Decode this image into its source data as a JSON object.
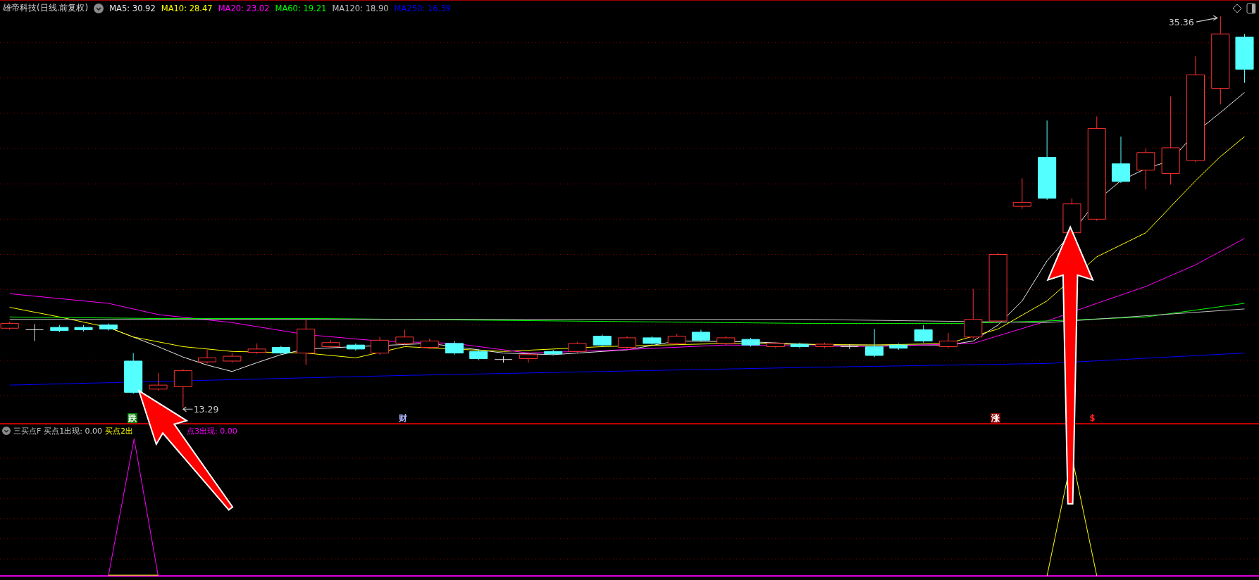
{
  "header": {
    "title": "雄帝科技(日线.前复权)",
    "indicators": [
      {
        "label": "MA5: 30.92",
        "color": "#e8e8e8"
      },
      {
        "label": "MA10: 28.47",
        "color": "#ffff00"
      },
      {
        "label": "MA20: 23.02",
        "color": "#ff00ff"
      },
      {
        "label": "MA60: 19.21",
        "color": "#00ff00"
      },
      {
        "label": "MA120: 18.90",
        "color": "#c0c0c0"
      },
      {
        "label": "MA250: 16.39",
        "color": "#0000ff"
      }
    ]
  },
  "price_chart": {
    "high_label": "35.36",
    "low_label": "13.29"
  },
  "signal_marks": [
    {
      "text": "跌",
      "kind": "boxed",
      "color": "#008000"
    },
    {
      "text": "财",
      "kind": "plain",
      "color": "#b0b8ff"
    },
    {
      "text": "涨",
      "kind": "boxed",
      "color": "#8b0000"
    },
    {
      "text": "$",
      "kind": "plain",
      "color": "#ff2020"
    }
  ],
  "indicator_panel": {
    "name": "三买点F",
    "values": [
      {
        "text": "买点1出现: 0.00",
        "color": "#d0d0d0"
      },
      {
        "text": "买点2出",
        "color": "#ffff00"
      },
      {
        "text": "点3出现: 0.00",
        "color": "#ff00ff"
      }
    ]
  }
}
